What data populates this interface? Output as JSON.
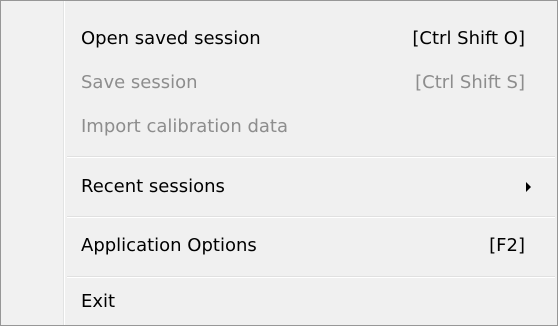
{
  "menu": {
    "items": [
      {
        "label": "Open saved session",
        "shortcut": "[Ctrl Shift O]"
      },
      {
        "label": "Save session",
        "shortcut": "[Ctrl Shift S]"
      },
      {
        "label": "Import calibration data"
      },
      {
        "label": "Recent sessions",
        "submenu_icon": "chevron-right-icon"
      },
      {
        "label": "Application Options",
        "shortcut": "[F2]"
      },
      {
        "label": "Exit"
      }
    ]
  },
  "colors": {
    "enabled_text": "#000000",
    "disabled_text": "#8d8d8d",
    "menu_background": "#f0f0f0"
  }
}
